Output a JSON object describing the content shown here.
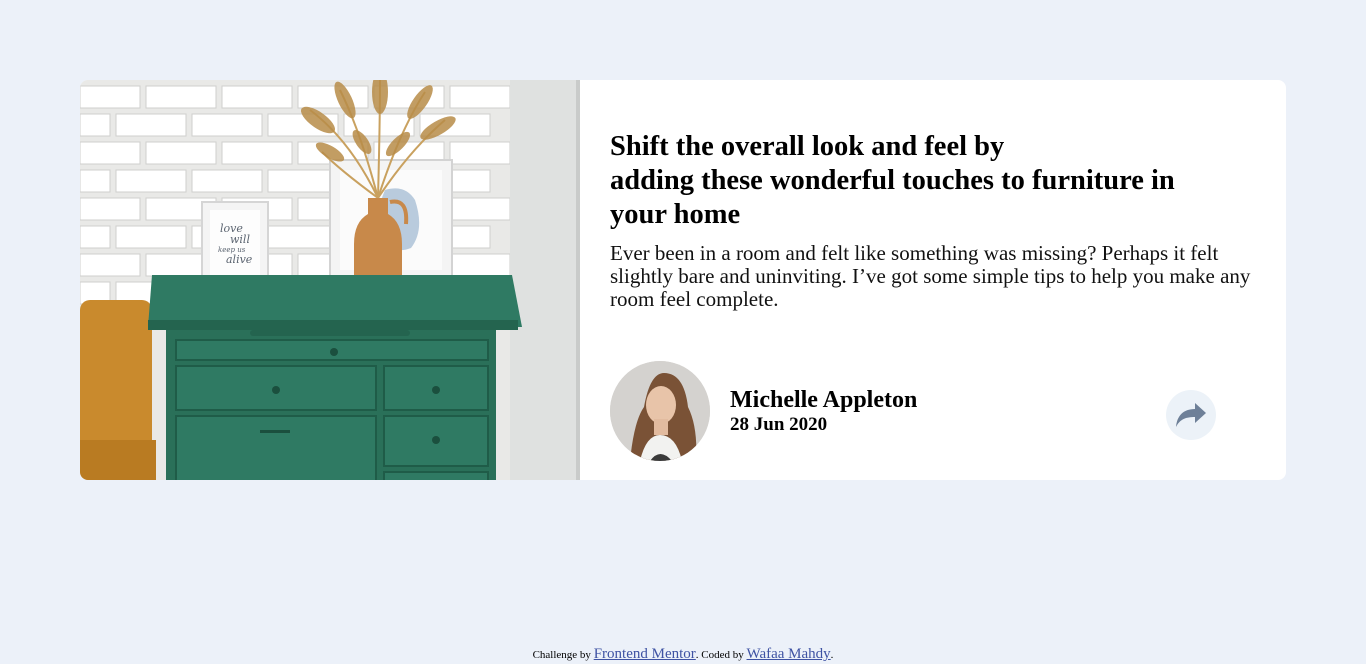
{
  "article": {
    "title_line1": "Shift the overall look and feel by",
    "title_line2": "adding these wonderful touches to furniture in",
    "title_line3": "your home",
    "description": "Ever been in a room and felt like something was missing? Perhaps it felt slightly bare and uninviting. I’ve got some simple tips to help you make any room feel complete.",
    "image_subject": "green drawer chest with vase and framed prints",
    "frame_text": [
      "love",
      "will",
      "keep us",
      "alive"
    ]
  },
  "author": {
    "name": "Michelle Appleton",
    "date": "28 Jun 2020",
    "avatar_subject": "portrait of author"
  },
  "share": {
    "icon": "share-icon"
  },
  "attribution": {
    "prefix": "Challenge by",
    "challenge_link": "Frontend Mentor",
    "middle": ". Coded by",
    "coder_link": "Wafaa Mahdy",
    "suffix": "."
  },
  "colors": {
    "page_background": "#ecf1f9",
    "card_background": "#ffffff",
    "share_button": "#ecf2f8",
    "share_icon": "#6e8098",
    "link": "#3e52a3"
  }
}
